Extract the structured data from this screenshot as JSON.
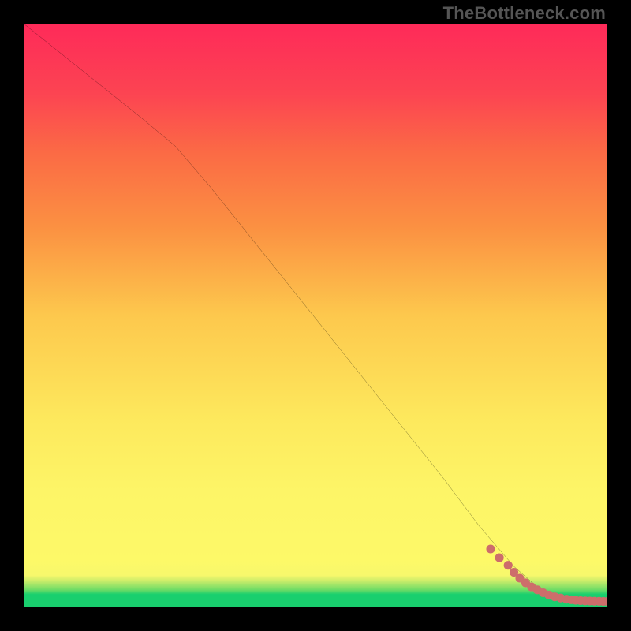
{
  "watermark": "TheBottleneck.com",
  "chart_data": {
    "type": "line",
    "title": "",
    "xlabel": "",
    "ylabel": "",
    "xlim": [
      0,
      100
    ],
    "ylim": [
      0,
      100
    ],
    "grid": false,
    "legend": false,
    "series": [
      {
        "name": "curve",
        "style": "solid-thin-black",
        "x": [
          0,
          10,
          20,
          26,
          32,
          40,
          48,
          56,
          64,
          72,
          78,
          84,
          88,
          91,
          94,
          96,
          98,
          100
        ],
        "y": [
          100,
          92,
          84,
          79,
          72,
          62,
          52,
          42,
          32,
          22,
          14,
          7,
          3.5,
          2,
          1.4,
          1.2,
          1.1,
          1.0
        ]
      },
      {
        "name": "markers",
        "style": "scatter-salmon",
        "x": [
          80.0,
          81.5,
          83.0,
          84.0,
          85.0,
          86.0,
          87.0,
          88.0,
          89.0,
          90.0,
          91.0,
          92.0,
          93.0,
          93.8,
          94.6,
          95.4,
          96.2,
          97.0,
          97.8,
          98.6,
          99.3,
          100.0
        ],
        "y": [
          10.0,
          8.5,
          7.2,
          6.0,
          5.0,
          4.2,
          3.5,
          3.0,
          2.5,
          2.1,
          1.8,
          1.6,
          1.4,
          1.3,
          1.2,
          1.15,
          1.1,
          1.08,
          1.06,
          1.04,
          1.02,
          1.0
        ]
      }
    ],
    "colors": {
      "curve": "#000000",
      "markers": "#cd6d6b",
      "gradient_top": "#fe2a59",
      "gradient_mid": "#fdf567",
      "gradient_bottom": "#19cf6e",
      "frame": "#000000"
    }
  }
}
